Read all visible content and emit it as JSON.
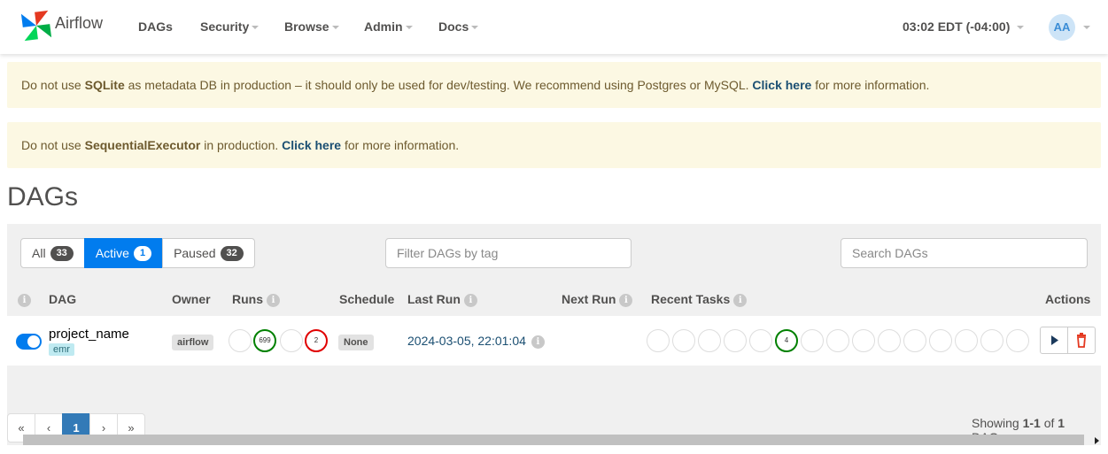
{
  "navbar": {
    "brand": "Airflow",
    "menu": [
      {
        "label": "DAGs",
        "dropdown": false
      },
      {
        "label": "Security",
        "dropdown": true
      },
      {
        "label": "Browse",
        "dropdown": true
      },
      {
        "label": "Admin",
        "dropdown": true
      },
      {
        "label": "Docs",
        "dropdown": true
      }
    ],
    "time": "03:02 EDT (-04:00)",
    "avatar": "AA"
  },
  "alerts": [
    {
      "pre": "Do not use ",
      "bold": "SQLite",
      "mid": " as metadata DB in production – it should only be used for dev/testing. We recommend using Postgres or MySQL. ",
      "link": "Click here",
      "post": " for more information."
    },
    {
      "pre": "Do not use ",
      "bold": "SequentialExecutor",
      "mid": " in production. ",
      "link": "Click here",
      "post": " for more information."
    }
  ],
  "page_title": "DAGs",
  "filters": {
    "all": {
      "label": "All",
      "count": "33"
    },
    "active": {
      "label": "Active",
      "count": "1"
    },
    "paused": {
      "label": "Paused",
      "count": "32"
    },
    "tag_placeholder": "Filter DAGs by tag",
    "search_placeholder": "Search DAGs"
  },
  "columns": {
    "dag": "DAG",
    "owner": "Owner",
    "runs": "Runs",
    "schedule": "Schedule",
    "last_run": "Last Run",
    "next_run": "Next Run",
    "recent_tasks": "Recent Tasks",
    "actions": "Actions"
  },
  "info_icon": "i",
  "rows": [
    {
      "name": "project_name",
      "tag": "emr",
      "owner": "airflow",
      "runs": {
        "success": "699",
        "failed": "2"
      },
      "schedule": "None",
      "last_run": "2024-03-05, 22:01:04",
      "recent_tasks_success": "4"
    }
  ],
  "pagination": {
    "first": "«",
    "prev": "‹",
    "current": "1",
    "next": "›",
    "last": "»"
  },
  "showing": {
    "prefix": "Showing ",
    "range": "1-1",
    "of": " of ",
    "total": "1",
    "suffix": " DAGs"
  },
  "colors": {
    "accent": "#017cee",
    "success": "#008000",
    "failed": "#e00000",
    "alert_bg": "#fcf8e3"
  }
}
